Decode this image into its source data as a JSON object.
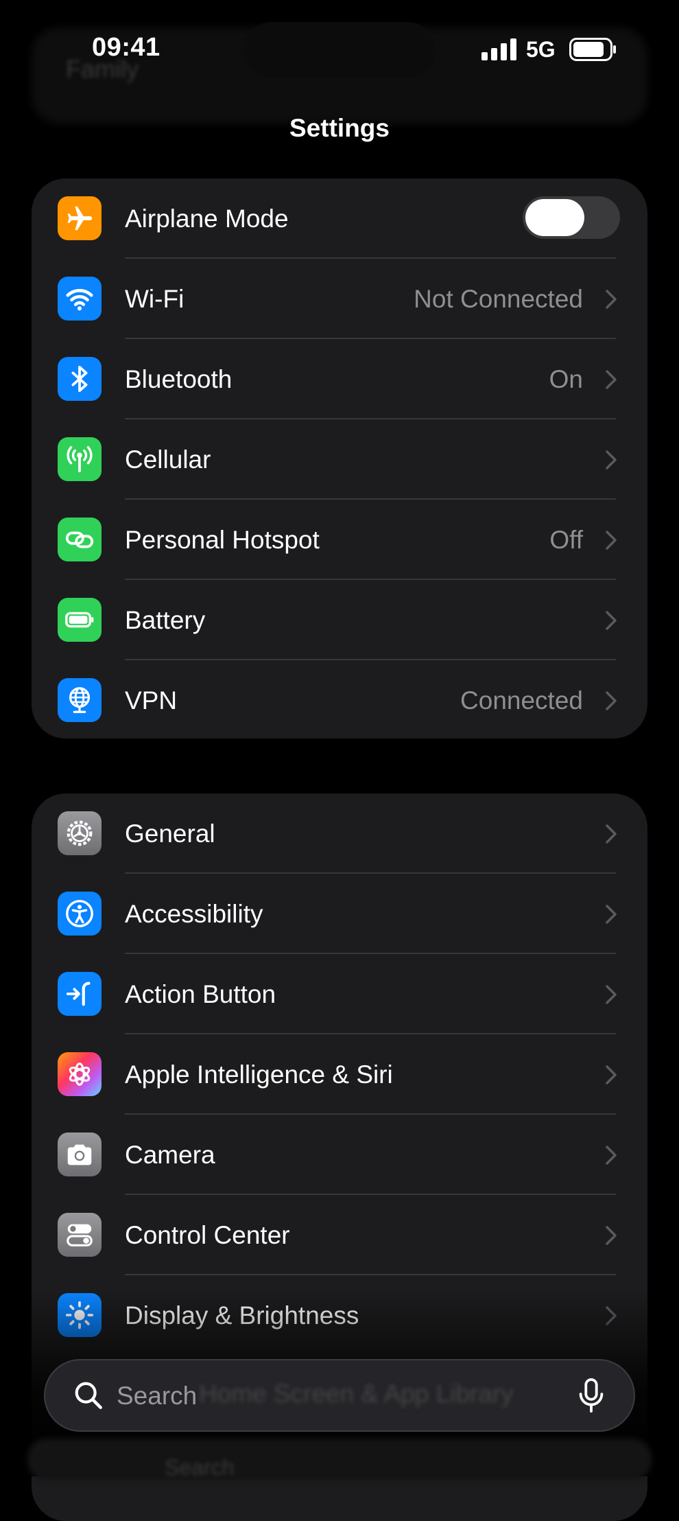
{
  "status_bar": {
    "time": "09:41",
    "network": "5G"
  },
  "background_text": {
    "family": "Family"
  },
  "header": {
    "title": "Settings"
  },
  "groups": [
    {
      "rows": [
        {
          "label": "Airplane Mode",
          "value": "",
          "icon": "airplane-icon",
          "color": "#ff9500",
          "toggle": true
        },
        {
          "label": "Wi-Fi",
          "value": "Not Connected",
          "icon": "wifi-icon",
          "color": "#0a84ff"
        },
        {
          "label": "Bluetooth",
          "value": "On",
          "icon": "bluetooth-icon",
          "color": "#0a84ff"
        },
        {
          "label": "Cellular",
          "value": "",
          "icon": "antenna-icon",
          "color": "#30d158"
        },
        {
          "label": "Personal Hotspot",
          "value": "Off",
          "icon": "link-icon",
          "color": "#30d158"
        },
        {
          "label": "Battery",
          "value": "",
          "icon": "battery-icon",
          "color": "#30d158"
        },
        {
          "label": "VPN",
          "value": "Connected",
          "icon": "globe-icon",
          "color": "#0a84ff"
        }
      ]
    },
    {
      "rows": [
        {
          "label": "General",
          "icon": "gear-icon",
          "color": "#8e8e93"
        },
        {
          "label": "Accessibility",
          "icon": "accessibility-icon",
          "color": "#0a84ff"
        },
        {
          "label": "Action Button",
          "icon": "action-button-icon",
          "color": "#0a84ff"
        },
        {
          "label": "Apple Intelligence & Siri",
          "icon": "apple-intelligence-icon",
          "color": "#ff6b6b"
        },
        {
          "label": "Camera",
          "icon": "camera-icon",
          "color": "#8e8e93"
        },
        {
          "label": "Control Center",
          "icon": "control-center-icon",
          "color": "#8e8e93"
        },
        {
          "label": "Display & Brightness",
          "icon": "sun-icon",
          "color": "#0a84ff"
        }
      ]
    }
  ],
  "behind_search": {
    "text": "Home Screen & App Library",
    "next": "Search"
  },
  "search": {
    "placeholder": "Search"
  }
}
